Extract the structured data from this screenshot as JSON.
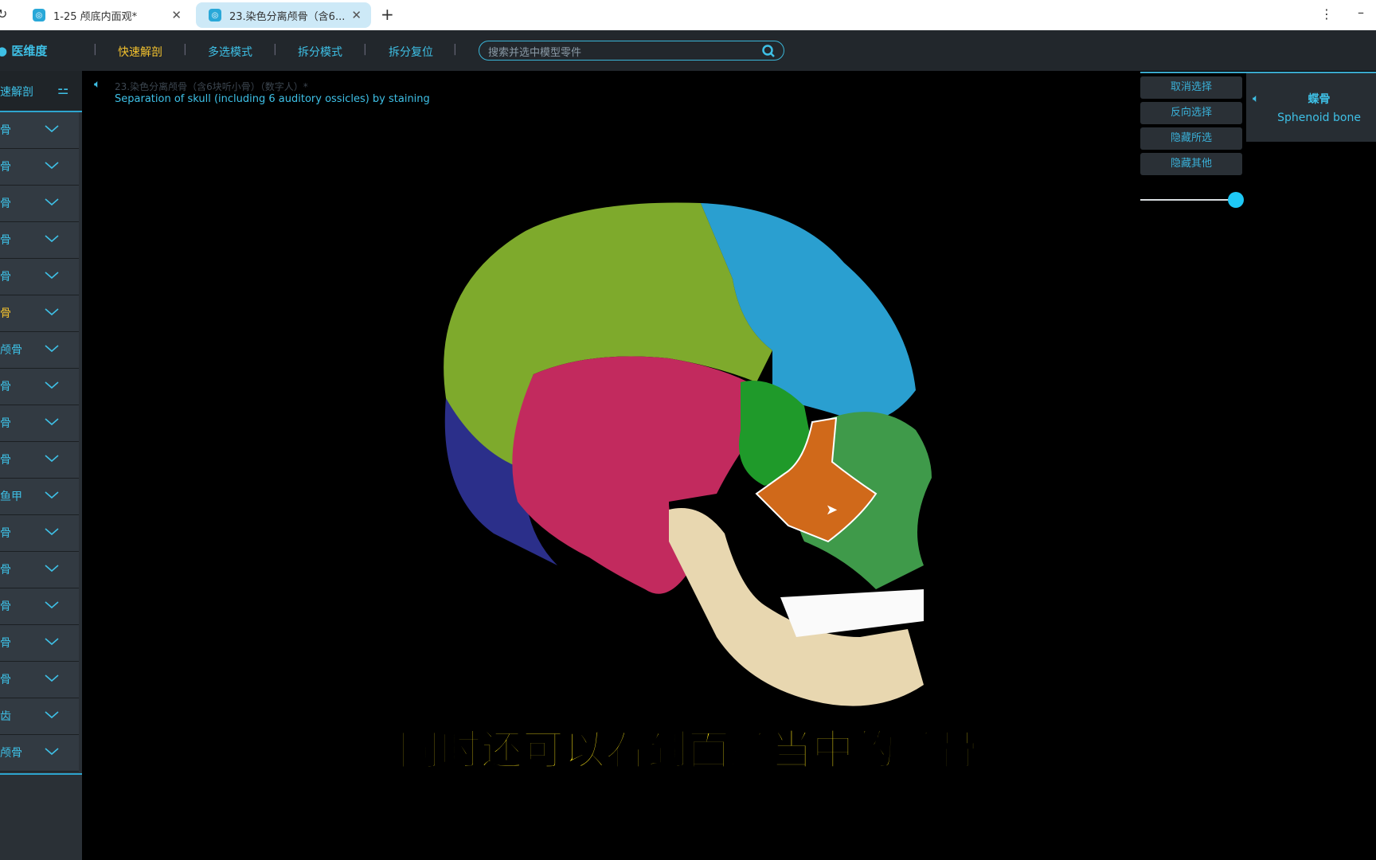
{
  "tabs": [
    {
      "label": "1-25 颅底内面观*",
      "active": false
    },
    {
      "label": "23.染色分离颅骨（含6...",
      "active": true
    }
  ],
  "new_tab": "+",
  "toolbar": {
    "logo": "医维度",
    "items": [
      "快速解剖",
      "多选模式",
      "拆分模式",
      "拆分复位"
    ],
    "search_placeholder": "搜索并选中模型零件"
  },
  "sidebar": {
    "header": "速解剖",
    "items": [
      "骨",
      "骨",
      "骨",
      "骨",
      "骨",
      "骨",
      "颅骨",
      "骨",
      "骨",
      "骨",
      "鱼甲",
      "骨",
      "骨",
      "骨",
      "骨",
      "骨",
      "齿",
      "颅骨"
    ],
    "highlighted_index": 5
  },
  "model": {
    "title_cn": "23.染色分离颅骨（含6块听小骨）（数字人）*",
    "title_en": "Separation of skull (including 6 auditory ossicles) by staining"
  },
  "actions": [
    "取消选择",
    "反向选择",
    "隐藏所选",
    "隐藏其他"
  ],
  "opacity_slider": 1.0,
  "selection": {
    "name_cn": "蝶骨",
    "name_en": "Sphenoid bone"
  },
  "subtitle": "同时还可以看到面颅当中的颧骨",
  "colors": {
    "accent": "#3ec0e6",
    "highlight": "#f2c12e",
    "subtitle": "#ffe81a"
  }
}
